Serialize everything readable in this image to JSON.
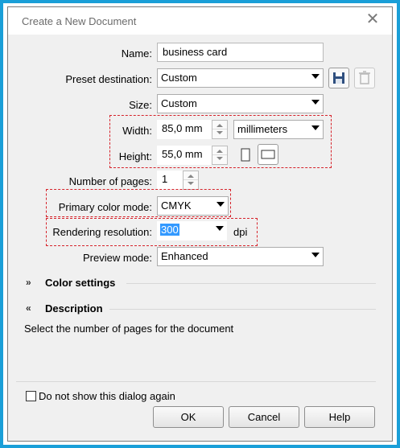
{
  "dialog": {
    "title": "Create a New Document"
  },
  "fields": {
    "name_label": "Name:",
    "name_value": "business card",
    "preset_label": "Preset destination:",
    "preset_value": "Custom",
    "size_label": "Size:",
    "size_value": "Custom",
    "width_label": "Width:",
    "width_value": "85,0 mm",
    "units_value": "millimeters",
    "height_label": "Height:",
    "height_value": "55,0 mm",
    "pages_label": "Number of pages:",
    "pages_value": "1",
    "color_mode_label": "Primary color mode:",
    "color_mode_value": "CMYK",
    "resolution_label": "Rendering resolution:",
    "resolution_value": "300",
    "resolution_unit": "dpi",
    "preview_label": "Preview mode:",
    "preview_value": "Enhanced"
  },
  "sections": {
    "color_settings": "Color settings",
    "description": "Description",
    "description_text": "Select the number of pages for the document"
  },
  "footer": {
    "dont_show_label": "Do not show this dialog again",
    "dont_show_checked": false,
    "ok": "OK",
    "cancel": "Cancel",
    "help": "Help"
  },
  "colors": {
    "accent_border": "#1a9fd8",
    "highlight_box": "#d6232b",
    "selection": "#3399ff"
  }
}
